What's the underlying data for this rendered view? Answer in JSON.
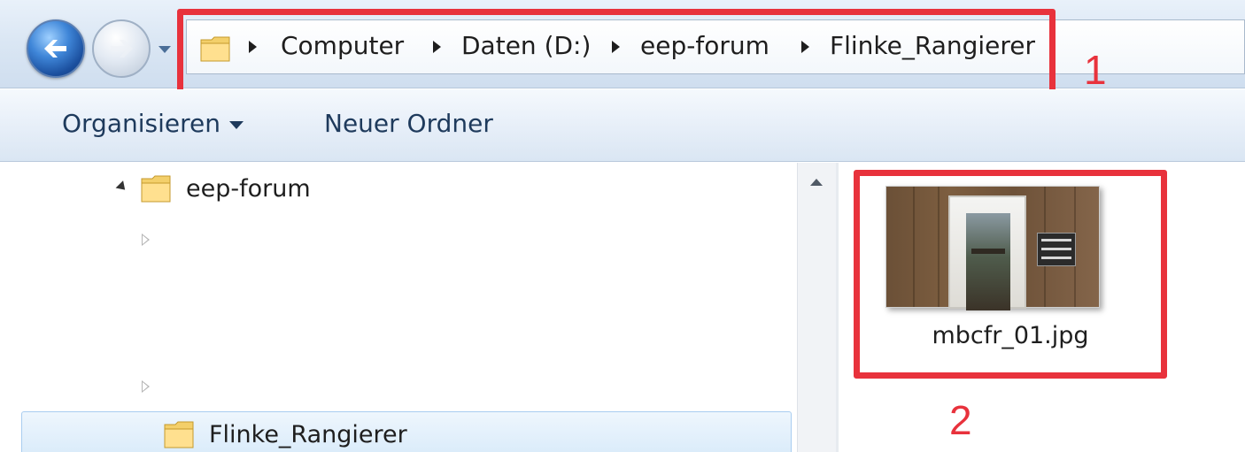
{
  "address_bar": {
    "breadcrumbs": [
      "Computer",
      "Daten (D:)",
      "eep-forum",
      "Flinke_Rangierer"
    ]
  },
  "command_bar": {
    "organize_label": "Organisieren",
    "new_folder_label": "Neuer Ordner"
  },
  "navigation_tree": {
    "items": [
      {
        "label": "eep-forum",
        "state": "expanded"
      },
      {
        "label": "",
        "state": "collapsed"
      },
      {
        "label": "",
        "state": "collapsed"
      },
      {
        "label": "Flinke_Rangierer",
        "state": "selected"
      }
    ]
  },
  "content": {
    "files": [
      {
        "name": "mbcfr_01.jpg"
      }
    ]
  },
  "annotations": {
    "box_1": "1",
    "box_2": "2"
  },
  "colors": {
    "annotation_red": "#e8323c",
    "selection_blue": "#d9ebfa",
    "command_text": "#1e3a5c"
  },
  "icons": {
    "back": "back-arrow-icon",
    "forward": "forward-arrow-icon",
    "folder": "folder-icon",
    "breadcrumb_separator": "chevron-right-icon"
  }
}
